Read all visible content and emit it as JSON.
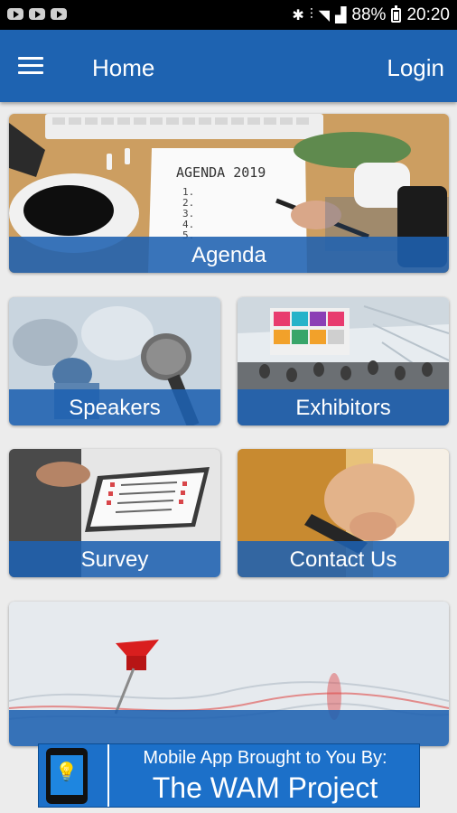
{
  "status_bar": {
    "battery": "88%",
    "time": "20:20"
  },
  "app_bar": {
    "title": "Home",
    "login_label": "Login"
  },
  "tiles": [
    {
      "label": "Agenda"
    },
    {
      "label": "Speakers"
    },
    {
      "label": "Exhibitors"
    },
    {
      "label": "Survey"
    },
    {
      "label": "Contact Us"
    },
    {
      "label": ""
    }
  ],
  "agenda_image_text": {
    "heading": "AGENDA 2019",
    "items": [
      "1.",
      "2.",
      "3.",
      "4.",
      "5."
    ]
  },
  "banner": {
    "line1": "Mobile App Brought to You By:",
    "line2": "The WAM Project"
  },
  "colors": {
    "app_bar": "#1e63b1",
    "tile_label_bg": "#1e61b0",
    "banner_bg": "#1c70c9"
  }
}
